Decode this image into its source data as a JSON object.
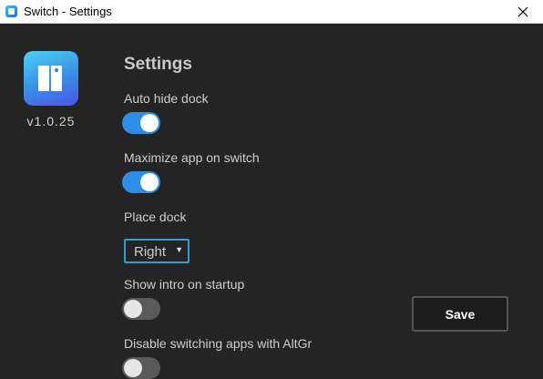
{
  "window": {
    "title": "Switch - Settings"
  },
  "sidebar": {
    "version": "v1.0.25"
  },
  "settings": {
    "heading": "Settings",
    "auto_hide_dock": {
      "label": "Auto hide dock",
      "enabled": true
    },
    "maximize_app": {
      "label": "Maximize app on switch",
      "enabled": true
    },
    "place_dock": {
      "label": "Place dock",
      "selected": "Right"
    },
    "show_intro": {
      "label": "Show intro on startup",
      "enabled": false
    },
    "disable_altgr": {
      "label": "Disable switching apps with AltGr",
      "enabled": false
    }
  },
  "actions": {
    "save_label": "Save"
  },
  "colors": {
    "accent": "#2d8ee8",
    "background": "#242424",
    "select_border": "#2d9fd8"
  }
}
